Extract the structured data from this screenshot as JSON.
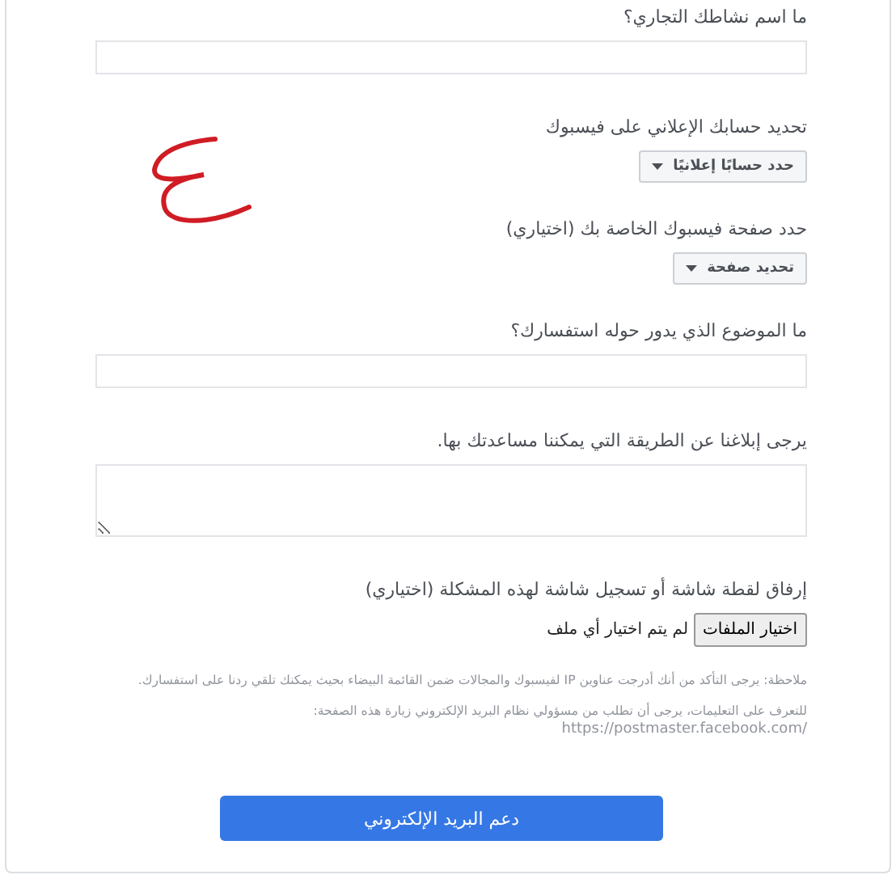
{
  "fields": [
    {
      "kind": "text",
      "label": "ما اسم نشاطك التجاري؟"
    },
    {
      "kind": "select",
      "label": "تحديد حسابك الإعلاني على فيسبوك",
      "button": "حدد حسابًا إعلانيًا"
    },
    {
      "kind": "select",
      "label": "حدد صفحة فيسبوك الخاصة بك (اختياري)",
      "button": "تحديد صفحة"
    },
    {
      "kind": "text",
      "label": "ما الموضوع الذي يدور حوله استفسارك؟"
    },
    {
      "kind": "textarea",
      "label": "يرجى إبلاغنا عن الطريقة التي يمكننا مساعدتك بها."
    },
    {
      "kind": "file",
      "label": "إرفاق لقطة شاشة أو تسجيل شاشة لهذه المشكلة (اختياري)",
      "button": "اختيار الملفات",
      "status": "لم يتم اختيار أي ملف"
    }
  ],
  "note": "ملاحظة: يرجى التأكد من أنك أدرجت عناوين IP لفيسبوك والمجالات ضمن القائمة البيضاء بحيث يمكنك تلقي ردنا على استفسارك.",
  "info": "للتعرف على التعليمات، يرجى أن تطلب من مسؤولي نظام البريد الإلكتروني زيارة هذه الصفحة:",
  "link": "https://postmaster.facebook.com/",
  "submit": "دعم البريد الإلكتروني"
}
